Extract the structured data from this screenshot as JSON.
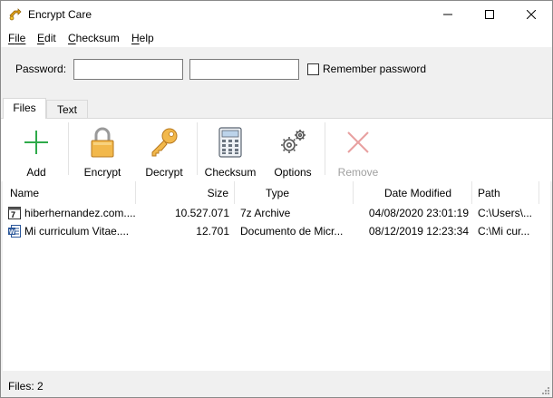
{
  "window": {
    "title": "Encrypt Care"
  },
  "menu": [
    {
      "key": "F",
      "rest": "ile"
    },
    {
      "key": "E",
      "rest": "dit"
    },
    {
      "key": "C",
      "rest": "hecksum"
    },
    {
      "key": "H",
      "rest": "elp"
    }
  ],
  "password": {
    "label": "Password:",
    "value1": "",
    "value2": "",
    "remember_label": "Remember password",
    "remember_checked": false
  },
  "tabs": [
    {
      "label": "Files",
      "active": true
    },
    {
      "label": "Text",
      "active": false
    }
  ],
  "toolbar": {
    "add": "Add",
    "encrypt": "Encrypt",
    "decrypt": "Decrypt",
    "checksum": "Checksum",
    "options": "Options",
    "remove": "Remove"
  },
  "list": {
    "headers": [
      "Name",
      "Size",
      "Type",
      "Date Modified",
      "Path"
    ],
    "rows": [
      {
        "icon": "archive-icon",
        "name": "hiberhernandez.com....",
        "size": "10.527.071",
        "type": "7z Archive",
        "date": "04/08/2020 23:01:19",
        "path": "C:\\Users\\..."
      },
      {
        "icon": "word-document-icon",
        "name": "Mi curriculum Vitae....",
        "size": "12.701",
        "type": "Documento de Micr...",
        "date": "08/12/2019 12:23:34",
        "path": "C:\\Mi cur..."
      }
    ]
  },
  "status": {
    "text": "Files: 2"
  },
  "colors": {
    "add_green": "#2eaa4a",
    "remove_red": "#e8a0a0",
    "lock_gold": "#e3a23a"
  }
}
